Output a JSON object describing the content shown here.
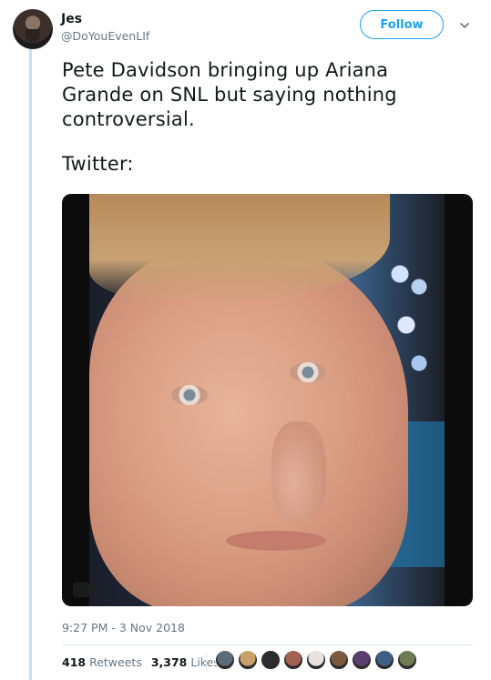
{
  "author": {
    "name": "Jes",
    "handle": "@DoYouEvenLIf"
  },
  "follow_label": "Follow",
  "tweet": {
    "text_line": "Pete Davidson bringing up Ariana Grande on SNL but saying nothing controversial.",
    "text_second": "Twitter:"
  },
  "timestamp": "9:27 PM - 3 Nov 2018",
  "stats": {
    "retweets_count": "418",
    "retweets_label": "Retweets",
    "likes_count": "3,378",
    "likes_label": "Likes"
  },
  "liker_colors": [
    "#5b6b78",
    "#c9a06a",
    "#2d2d2d",
    "#a26151",
    "#e9e1dc",
    "#7c5a3f",
    "#5a3f6e",
    "#3f5f86",
    "#6f7b55"
  ],
  "colors": {
    "accent": "#1da1f2",
    "secondary_text": "#657786",
    "thread_line": "#c5dff2"
  }
}
